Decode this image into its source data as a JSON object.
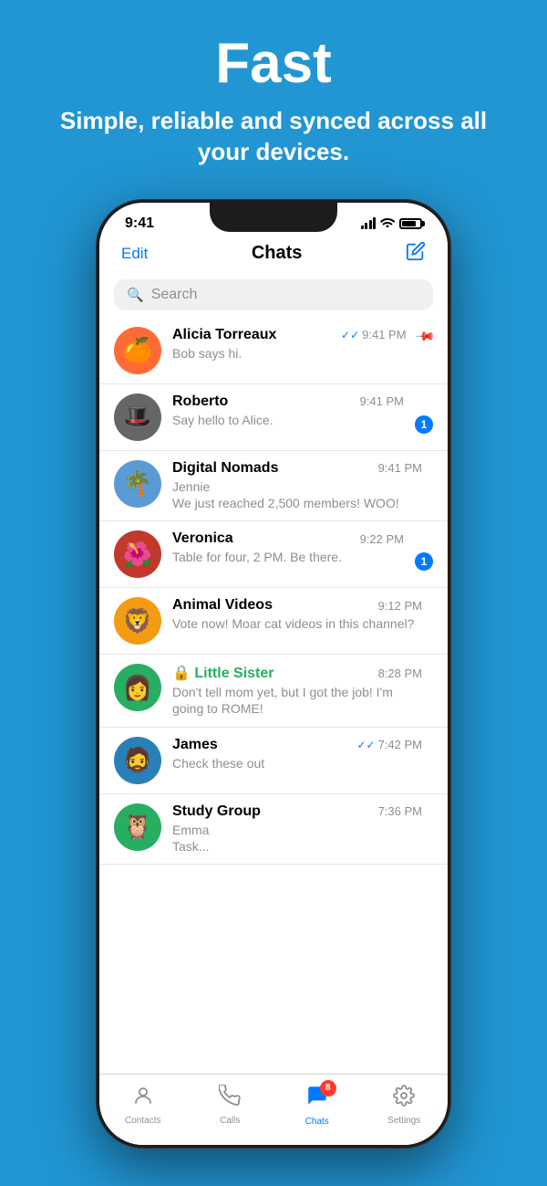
{
  "header": {
    "title": "Fast",
    "subtitle": "Simple, reliable and synced across all your devices."
  },
  "statusBar": {
    "time": "9:41"
  },
  "navBar": {
    "editLabel": "Edit",
    "title": "Chats"
  },
  "searchBar": {
    "placeholder": "Search"
  },
  "chats": [
    {
      "id": "alicia",
      "name": "Alicia Torreaux",
      "preview": "Bob says hi.",
      "time": "9:41 PM",
      "pinned": true,
      "doubleCheck": true,
      "badge": null,
      "avatarColor": "#ff6b35",
      "avatarEmoji": "🍊"
    },
    {
      "id": "roberto",
      "name": "Roberto",
      "preview": "Say hello to Alice.",
      "time": "9:41 PM",
      "pinned": false,
      "doubleCheck": false,
      "badge": "1",
      "avatarColor": "#666",
      "avatarEmoji": "🎩"
    },
    {
      "id": "digital",
      "name": "Digital Nomads",
      "sender": "Jennie",
      "preview": "We just reached 2,500 members! WOO!",
      "time": "9:41 PM",
      "pinned": false,
      "doubleCheck": false,
      "badge": null,
      "avatarColor": "#5b9bd5",
      "avatarEmoji": "🌴"
    },
    {
      "id": "veronica",
      "name": "Veronica",
      "preview": "Table for four, 2 PM. Be there.",
      "time": "9:22 PM",
      "pinned": false,
      "doubleCheck": false,
      "badge": "1",
      "avatarColor": "#c0392b",
      "avatarEmoji": "🌺"
    },
    {
      "id": "animal",
      "name": "Animal Videos",
      "preview": "Vote now! Moar cat videos in this channel?",
      "time": "9:12 PM",
      "pinned": false,
      "doubleCheck": false,
      "badge": null,
      "avatarColor": "#f39c12",
      "avatarEmoji": "🦁"
    },
    {
      "id": "sister",
      "name": "Little Sister",
      "preview": "Don't tell mom yet, but I got the job! I'm going to ROME!",
      "time": "8:28 PM",
      "pinned": false,
      "doubleCheck": false,
      "badge": null,
      "green": true,
      "lock": true,
      "avatarColor": "#27ae60",
      "avatarEmoji": "👩"
    },
    {
      "id": "james",
      "name": "James",
      "preview": "Check these out",
      "time": "7:42 PM",
      "pinned": false,
      "doubleCheck": true,
      "badge": null,
      "avatarColor": "#2980b9",
      "avatarEmoji": "🧔"
    },
    {
      "id": "study",
      "name": "Study Group",
      "sender": "Emma",
      "preview": "Task...",
      "time": "7:36 PM",
      "pinned": false,
      "doubleCheck": false,
      "badge": null,
      "avatarColor": "#27ae60",
      "avatarEmoji": "🦉"
    }
  ],
  "tabBar": {
    "tabs": [
      {
        "id": "contacts",
        "label": "Contacts",
        "icon": "👤",
        "active": false
      },
      {
        "id": "calls",
        "label": "Calls",
        "icon": "📞",
        "active": false
      },
      {
        "id": "chats",
        "label": "Chats",
        "icon": "💬",
        "active": true,
        "badge": "8"
      },
      {
        "id": "settings",
        "label": "Settings",
        "icon": "⚙️",
        "active": false
      }
    ]
  }
}
